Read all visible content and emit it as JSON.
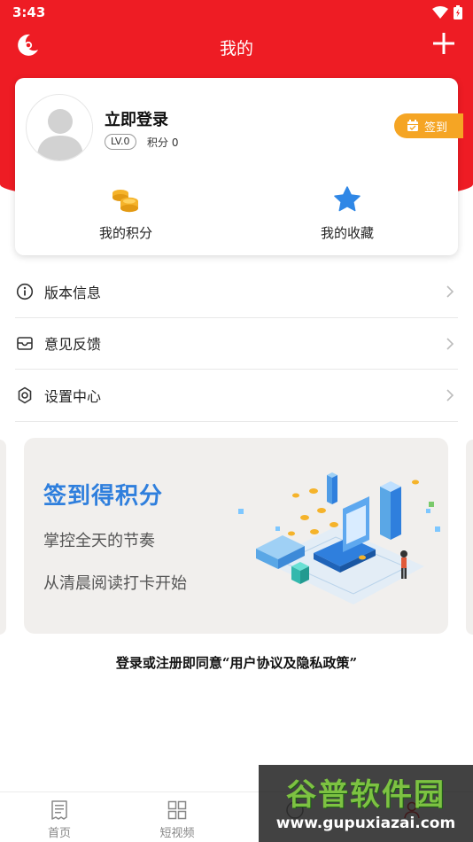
{
  "status_bar": {
    "time": "3:43"
  },
  "nav": {
    "title": "我的"
  },
  "profile": {
    "login_label": "立即登录",
    "level": "LV.0",
    "points_text": "积分 0",
    "checkin_label": "签到",
    "stats": [
      {
        "label": "我的积分",
        "icon": "coins-icon"
      },
      {
        "label": "我的收藏",
        "icon": "star-icon"
      }
    ]
  },
  "menu": [
    {
      "label": "版本信息",
      "icon": "info-icon"
    },
    {
      "label": "意见反馈",
      "icon": "feedback-inbox-icon"
    },
    {
      "label": "设置中心",
      "icon": "gear-icon"
    }
  ],
  "banner": {
    "title": "签到得积分",
    "line1": "掌控全天的节奏",
    "line2": "从清晨阅读打卡开始"
  },
  "agreement": "登录或注册即同意“用户协议及隐私政策”",
  "tabs": [
    {
      "label": "首页",
      "icon": "news-icon"
    },
    {
      "label": "短视频",
      "icon": "grid-icon"
    }
  ],
  "watermark": {
    "title": "谷普软件园",
    "url": "www.gupuxiazai.com"
  },
  "colors": {
    "brand_red": "#ee1c24",
    "checkin_orange": "#f5a524",
    "banner_blue": "#2f7fdd"
  }
}
